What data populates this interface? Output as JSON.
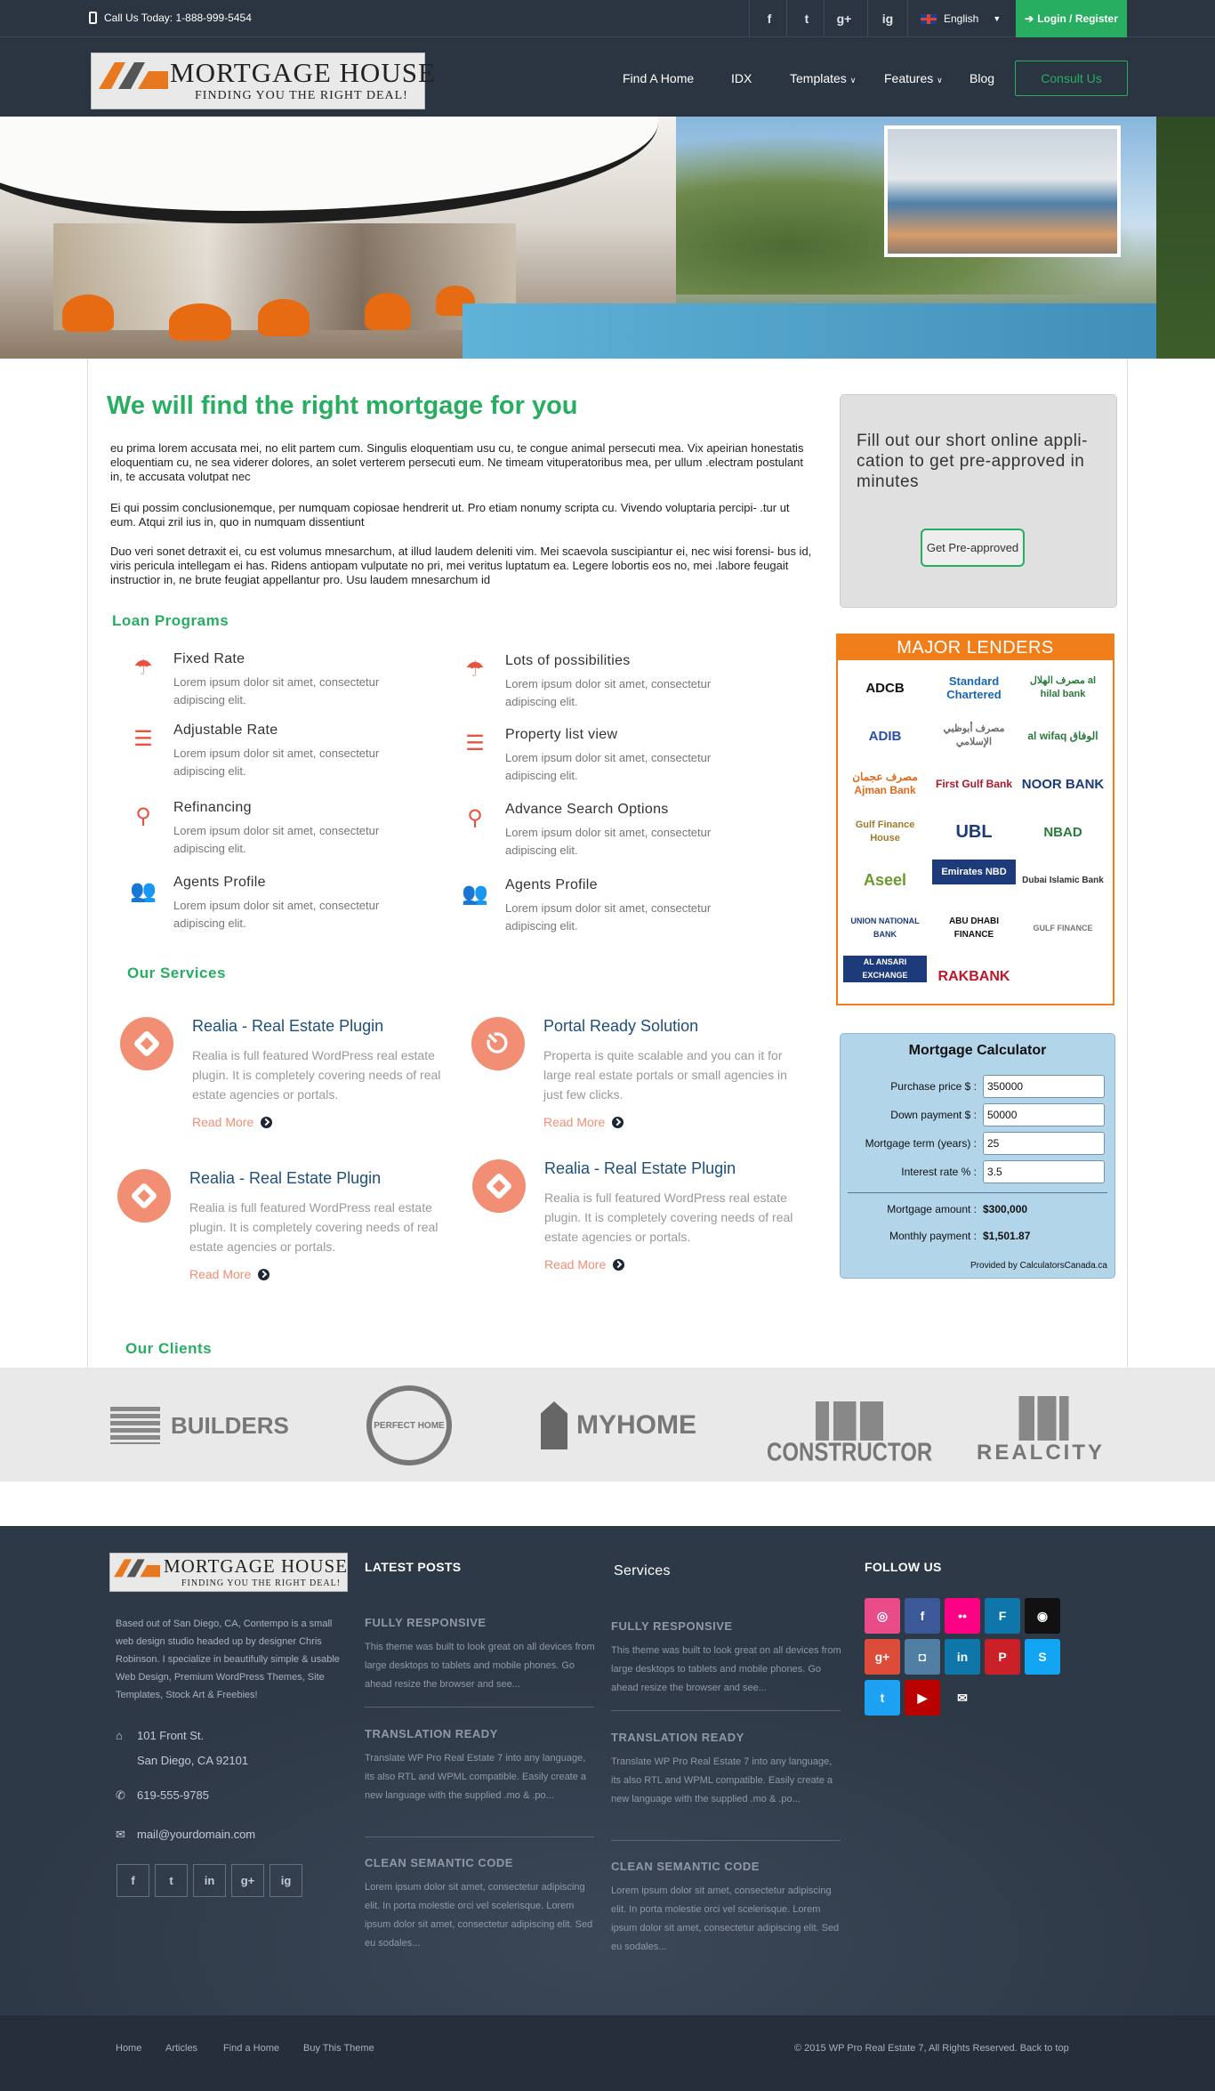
{
  "topbar": {
    "phone": "Call Us Today: 1-888-999-5454",
    "social": [
      "f",
      "t",
      "g+",
      "ig"
    ],
    "language": "English",
    "login": "Login / Register"
  },
  "header": {
    "logo_title": "MORTGAGE HOUSE",
    "logo_tagline": "FINDING YOU THE RIGHT DEAL!",
    "nav": [
      "Find A Home",
      "IDX",
      "Templates",
      "Features",
      "Blog"
    ],
    "consult": "Consult Us"
  },
  "main": {
    "title": "We will find the right mortgage for you",
    "paragraphs": [
      "eu prima lorem accusata mei, no elit partem cum. Singulis eloquentiam usu cu, te congue animal persecuti mea. Vix apeirian honestatis eloquentiam cu, ne sea viderer dolores, an solet verterem persecuti eum. Ne timeam vituperatoribus mea, per ullum .electram postulant in, te accusata volutpat nec",
      "Ei qui possim conclusionemque, per numquam copiosae hendrerit ut. Pro etiam nonumy scripta cu. Vivendo voluptaria percipi- .tur ut eum. Atqui zril ius in, quo in numquam dissentiunt",
      "Duo veri sonet detraxit ei, cu est volumus mnesarchum, at illud laudem deleniti vim. Mei scaevola suscipiantur ei, nec wisi forensi- bus id, viris pericula intellegam ei has. Ridens antiopam vulputate no pri, mei veritus luptatum ea. Legere lobortis eos no, mei .labore feugait instructior in, ne brute feugiat appellantur pro. Usu laudem mnesarchum id"
    ],
    "loan_heading": "Loan Programs",
    "loans": [
      {
        "title": "Fixed Rate",
        "desc": "Lorem ipsum dolor sit amet, consectetur adipiscing elit.",
        "icon": "umbrella-icon"
      },
      {
        "title": "Lots of possibilities",
        "desc": "Lorem ipsum dolor sit amet, consectetur adipiscing elit.",
        "icon": "umbrella-icon"
      },
      {
        "title": "Adjustable Rate",
        "desc": "Lorem ipsum dolor sit amet, consectetur adipiscing elit.",
        "icon": "list-icon"
      },
      {
        "title": "Property list view",
        "desc": "Lorem ipsum dolor sit amet, consectetur adipiscing elit.",
        "icon": "list-icon"
      },
      {
        "title": "Refinancing",
        "desc": "Lorem ipsum dolor sit amet, consectetur adipiscing elit.",
        "icon": "search-icon"
      },
      {
        "title": "Advance Search Options",
        "desc": "Lorem ipsum dolor sit amet, consectetur adipiscing elit.",
        "icon": "search-icon"
      },
      {
        "title": "Agents Profile",
        "desc": "Lorem ipsum dolor sit amet, consectetur adipiscing elit.",
        "icon": "users-icon"
      },
      {
        "title": "Agents Profile",
        "desc": "Lorem ipsum dolor sit amet, consectetur adipiscing elit.",
        "icon": "users-icon"
      }
    ],
    "services_heading": "Our Services",
    "services": [
      {
        "title": "Realia - Real Estate Plugin",
        "desc": "Realia is full featured WordPress real estate plugin. It is completely covering needs of real estate agencies or portals.",
        "more": "Read More"
      },
      {
        "title": "Portal Ready Solution",
        "desc": "Properta is quite scalable and you can it for large real estate portals or small agencies in just few clicks.",
        "more": "Read More"
      },
      {
        "title": "Realia - Real Estate Plugin",
        "desc": "Realia is full featured WordPress real estate plugin. It is completely covering needs of real estate agencies or portals.",
        "more": "Read More"
      },
      {
        "title": "Realia - Real Estate Plugin",
        "desc": "Realia is full featured WordPress real estate plugin. It is completely covering needs of real estate agencies or portals.",
        "more": "Read More"
      }
    ],
    "clients_heading": "Our Clients",
    "clients": [
      "BUILDERS",
      "PERFECT HOME",
      "MYHOME",
      "CONSTRUCTOR",
      "REALCITY"
    ]
  },
  "sidebar": {
    "preapproval_text": "Fill out our short online appli- cation to get pre-approved in minutes",
    "preapproval_button": "Get Pre-approved",
    "lenders_heading": "MAJOR LENDERS",
    "lenders": [
      "ADCB",
      "Standard Chartered",
      "مصرف الهلال al hilal bank",
      "ADIB",
      "مصرف أبوظبي الإسلامي",
      "al wifaq الوفاق",
      "مصرف عجمان Ajman Bank",
      "First Gulf Bank",
      "NOOR BANK",
      "Gulf Finance House",
      "UBL",
      "NBAD",
      "Aseel",
      "Emirates NBD",
      "Dubai Islamic Bank",
      "UNION NATIONAL BANK",
      "ABU DHABI FINANCE",
      "GULF FINANCE",
      "AL ANSARI EXCHANGE",
      "RAKBANK"
    ],
    "calculator": {
      "title": "Mortgage Calculator",
      "fields": [
        {
          "label": "Purchase price $ :",
          "value": "350000"
        },
        {
          "label": "Down payment $ :",
          "value": "50000"
        },
        {
          "label": "Mortgage term (years) :",
          "value": "25"
        },
        {
          "label": "Interest rate % :",
          "value": "3.5"
        }
      ],
      "results": [
        {
          "label": "Mortgage amount :",
          "value": "$300,000"
        },
        {
          "label": "Monthly payment :",
          "value": "$1,501.87"
        }
      ],
      "provided": "Provided by CalculatorsCanada.ca"
    }
  },
  "footer": {
    "about": "Based out of San Diego, CA, Contempo is a small web design studio headed up by designer Chris Robinson. I specialize in beautifully simple & usable Web Design, Premium WordPress Themes, Site Templates, Stock Art & Freebies!",
    "address1": "101 Front St.",
    "address2": "San Diego, CA 92101",
    "phone": "619-555-9785",
    "email": "mail@yourdomain.com",
    "social": [
      "f",
      "t",
      "in",
      "g+",
      "ig"
    ],
    "latest_heading": "LATEST POSTS",
    "services_heading": "Services",
    "follow_heading": "FOLLOW US",
    "posts": [
      {
        "title": "FULLY RESPONSIVE",
        "desc": "This theme was built to look great on all devices from large desktops to tablets and mobile phones. Go ahead resize the browser and see..."
      },
      {
        "title": "TRANSLATION READY",
        "desc": "Translate WP Pro Real Estate 7 into any language, its also RTL and WPML compatible. Easily create a new language with the supplied .mo & .po..."
      },
      {
        "title": "CLEAN SEMANTIC CODE",
        "desc": "Lorem ipsum dolor sit amet, consectetur adipiscing elit. In porta molestie orci vel scelerisque. Lorem ipsum dolor sit amet, consectetur adipiscing elit. Sed eu sodales..."
      }
    ],
    "follow": [
      {
        "name": "dribbble",
        "glyph": "◎",
        "color": "#ea4c89"
      },
      {
        "name": "facebook",
        "glyph": "f",
        "color": "#3b5998"
      },
      {
        "name": "flickr",
        "glyph": "••",
        "color": "#ff0084"
      },
      {
        "name": "foursquare",
        "glyph": "F",
        "color": "#0e76a8"
      },
      {
        "name": "github",
        "glyph": "◉",
        "color": "#111111"
      },
      {
        "name": "google-plus",
        "glyph": "g+",
        "color": "#dd4b39"
      },
      {
        "name": "instagram",
        "glyph": "◘",
        "color": "#517fa4"
      },
      {
        "name": "linkedin",
        "glyph": "in",
        "color": "#0e76a8"
      },
      {
        "name": "pinterest",
        "glyph": "P",
        "color": "#cb2027"
      },
      {
        "name": "skype",
        "glyph": "S",
        "color": "#12a5f4"
      },
      {
        "name": "twitter",
        "glyph": "t",
        "color": "#1da1f2"
      },
      {
        "name": "youtube",
        "glyph": "▶",
        "color": "#bb0000"
      },
      {
        "name": "email",
        "glyph": "✉",
        "color": "#2e3947"
      }
    ],
    "bottom_links": [
      "Home",
      "Articles",
      "Find a Home",
      "Buy This Theme"
    ],
    "copyright": "© 2015 WP Pro Real Estate 7, All Rights Reserved. Back to top"
  },
  "colors": {
    "accent": "#27ae60",
    "dark": "#2b3441",
    "coral": "#f18e74",
    "orange": "#f07f1b"
  }
}
